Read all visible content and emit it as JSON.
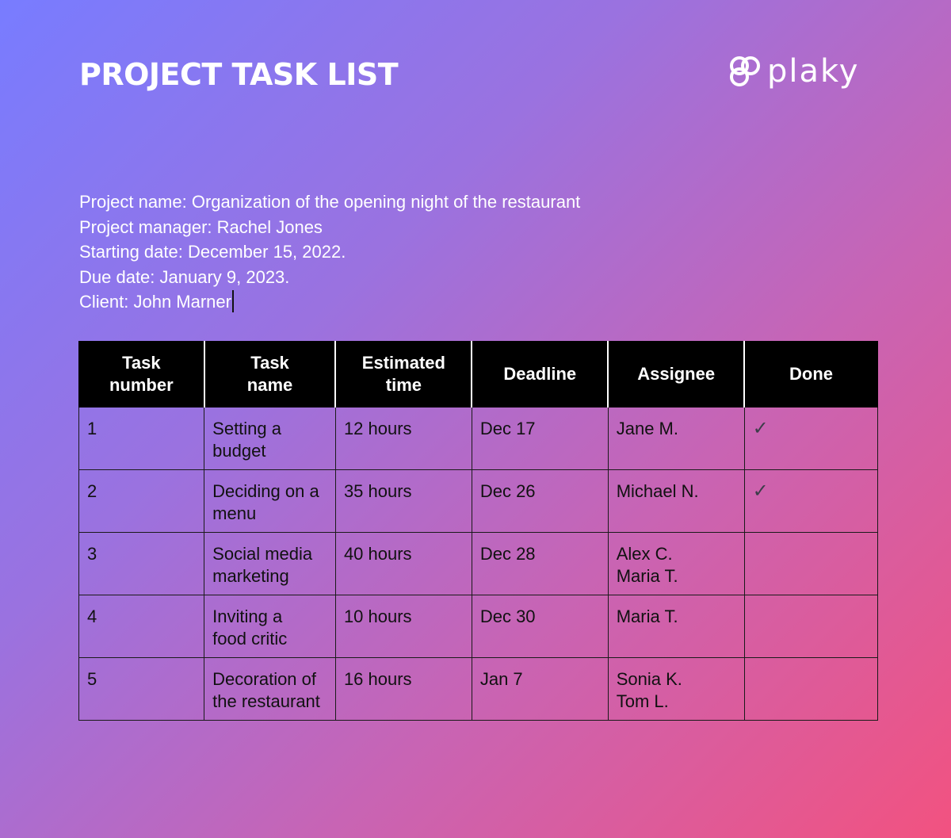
{
  "header": {
    "title": "PROJECT TASK LIST",
    "logo_text": "plaky",
    "logo_icon": "plaky-logo-icon"
  },
  "project_info": {
    "name": "Project name: Organization of the opening night of the restaurant",
    "manager": "Project manager: Rachel Jones",
    "start_date": "Starting date: December 15, 2022.",
    "due_date": "Due date: January 9, 2023.",
    "client": "Client: John Marner"
  },
  "table": {
    "headers": [
      "Task\nnumber",
      "Task\nname",
      "Estimated\ntime",
      "Deadline",
      "Assignee",
      "Done"
    ],
    "rows": [
      {
        "number": "1",
        "name": "Setting a budget",
        "time": "12 hours",
        "deadline": "Dec 17",
        "assignee": "Jane M.",
        "done": "✓"
      },
      {
        "number": "2",
        "name": "Deciding on a menu",
        "time": "35 hours",
        "deadline": "Dec 26",
        "assignee": "Michael N.",
        "done": "✓"
      },
      {
        "number": "3",
        "name": "Social media marketing",
        "time": "40 hours",
        "deadline": "Dec 28",
        "assignee": "Alex C. Maria T.",
        "done": ""
      },
      {
        "number": "4",
        "name": "Inviting a food critic",
        "time": "10 hours",
        "deadline": "Dec 30",
        "assignee": "Maria T.",
        "done": ""
      },
      {
        "number": "5",
        "name": "Decoration of the restaurant",
        "time": "16 hours",
        "deadline": "Jan 7",
        "assignee": "Sonia K. Tom L.",
        "done": ""
      }
    ]
  },
  "colors": {
    "gradient_start": "#787cff",
    "gradient_end": "#f25280",
    "header_bg": "#000000",
    "text_light": "#ffffff"
  }
}
